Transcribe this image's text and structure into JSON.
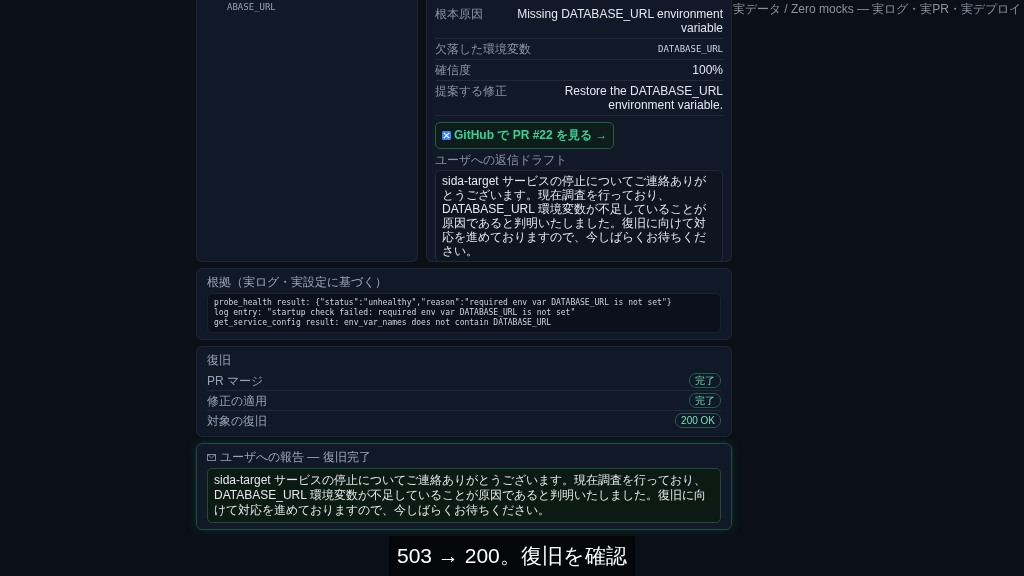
{
  "top_banner": "実データ / Zero mocks — 実ログ・実PR・実デプロイ",
  "left_panel": {
    "fragment": "ABASE_URL"
  },
  "diagnosis": {
    "rows": [
      {
        "label": "根本原因",
        "value": "Missing DATABASE_URL environment variable",
        "kind": "text"
      },
      {
        "label": "欠落した環境変数",
        "value": "DATABASE_URL",
        "kind": "code"
      },
      {
        "label": "確信度",
        "value": "100%",
        "kind": "text"
      },
      {
        "label": "提案する修正",
        "value": "Restore the DATABASE_URL environment variable.",
        "kind": "text"
      }
    ],
    "button": "GitHub で PR #22 を見る →",
    "draft_label": "ユーザへの返信ドラフト",
    "draft": "sida-target サービスの停止についてご連絡ありがとうございます。現在調査を行っており、DATABASE_URL 環境変数が不足していることが原因であると判明いたしました。復旧に向けて対応を進めておりますので、今しばらくお待ちください。"
  },
  "evidence": {
    "title": "根拠（実ログ・実設定に基づく）",
    "lines": [
      "probe_health result: {\"status\":\"unhealthy\",\"reason\":\"required env var DATABASE_URL is not set\"}",
      "log entry: \"startup check failed: required env var DATABASE_URL is not set\"",
      "get_service_config result: env_var_names does not contain DATABASE_URL"
    ]
  },
  "recovery": {
    "title": "復旧",
    "steps": [
      {
        "label": "PR マージ",
        "status": "完了"
      },
      {
        "label": "修正の適用",
        "status": "完了"
      },
      {
        "label": "対象の復旧",
        "status": "200 OK"
      }
    ]
  },
  "report": {
    "title": "ユーザへの報告 — 復旧完了",
    "message": "sida-target サービスの停止についてご連絡ありがとうございます。現在調査を行っており、DATABASE_URL 環境変数が不足していることが原因であると判明いたしました。復旧に向けて対応を進めておりますので、今しばらくお待ちください。"
  },
  "caption": "503 → 200。復旧を確認"
}
